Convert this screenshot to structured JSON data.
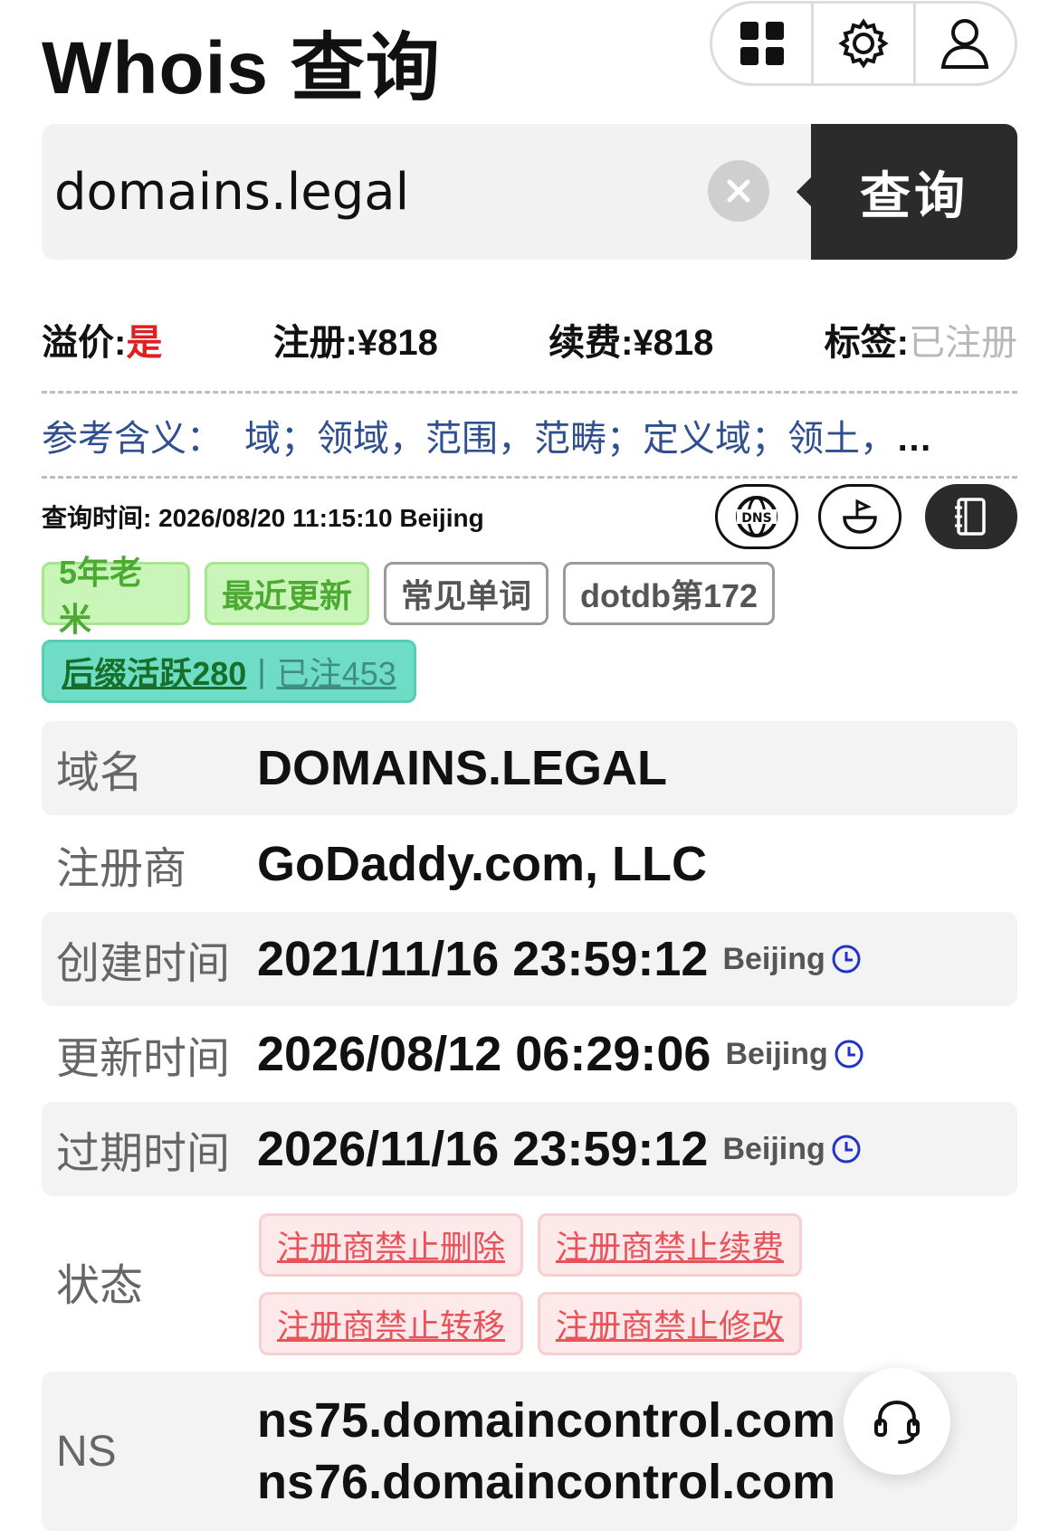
{
  "header": {
    "title": "Whois 查询"
  },
  "search": {
    "value": "domains.legal",
    "button_label": "查询"
  },
  "price": {
    "premium_label": "溢价:",
    "premium_value": "是",
    "register_label": "注册:",
    "register_value": "¥818",
    "renew_label": "续费:",
    "renew_value": "¥818",
    "tag_label": "标签:",
    "tag_value": "已注册"
  },
  "meaning": {
    "label": "参考含义：",
    "text": "域；领域，范围，范畴；定义域；领土，",
    "more": "…"
  },
  "query_time": {
    "text": "查询时间: 2026/08/20 11:15:10 Beijing"
  },
  "tags": [
    {
      "label": "5年老米"
    },
    {
      "label": "最近更新"
    },
    {
      "label": "常见单词"
    },
    {
      "label": "dotdb第172"
    }
  ],
  "suffix_tag": {
    "active": "后缀活跃280",
    "separator": "|",
    "registered": "已注453"
  },
  "whois": {
    "domain_key": "域名",
    "domain_value": "DOMAINS.LEGAL",
    "registrar_key": "注册商",
    "registrar_value": "GoDaddy.com, LLC",
    "created_key": "创建时间",
    "created_value": "2021/11/16 23:59:12",
    "created_tz": "Beijing",
    "updated_key": "更新时间",
    "updated_value": "2026/08/12 06:29:06",
    "updated_tz": "Beijing",
    "expires_key": "过期时间",
    "expires_value": "2026/11/16 23:59:12",
    "expires_tz": "Beijing",
    "status_key": "状态",
    "statuses": [
      "注册商禁止删除",
      "注册商禁止续费",
      "注册商禁止转移",
      "注册商禁止修改"
    ],
    "ns_key": "NS",
    "ns": [
      "ns75.domaincontrol.com",
      "ns76.domaincontrol.com"
    ]
  },
  "colors": {
    "accent_red": "#e02020",
    "dark": "#2b2b2b",
    "link_blue": "#2233cc"
  }
}
